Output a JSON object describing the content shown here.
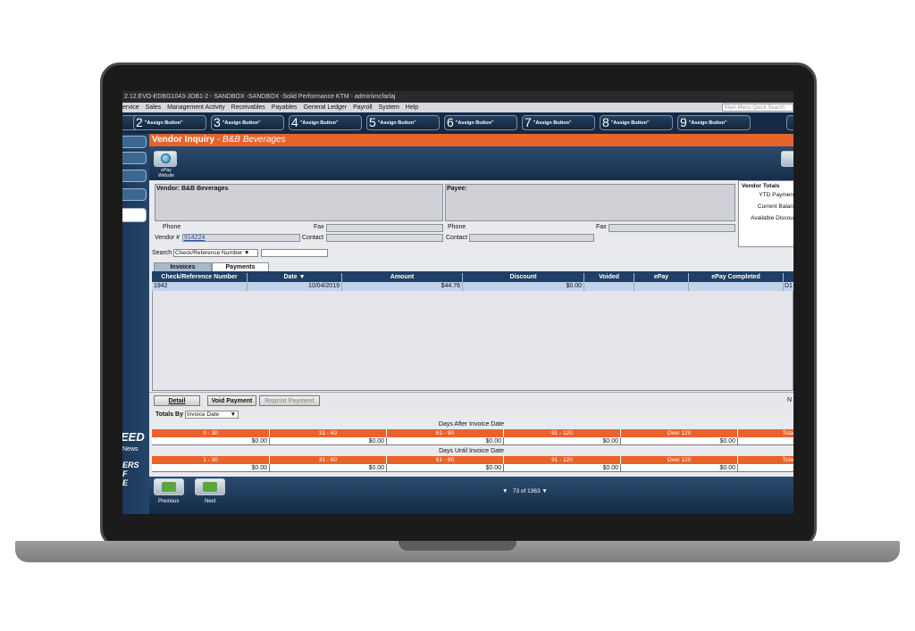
{
  "window": {
    "title": "2.12.EVO-EDBG1043-JOB1-2 - SANDBOX -SANDBOX -Solid Performance KTM - admin\\mcfarlaj"
  },
  "menu": {
    "items": [
      "ervice",
      "Sales",
      "Management Activity",
      "Receivables",
      "Payables",
      "General Ledger",
      "Payroll",
      "System",
      "Help"
    ],
    "quick_search_placeholder": "Main Menu Quick Search"
  },
  "assign_buttons": [
    {
      "num": "2",
      "label": "\"Assign Button\""
    },
    {
      "num": "3",
      "label": "\"Assign Button\""
    },
    {
      "num": "4",
      "label": "\"Assign Button\""
    },
    {
      "num": "5",
      "label": "\"Assign Button\""
    },
    {
      "num": "6",
      "label": "\"Assign Button\""
    },
    {
      "num": "7",
      "label": "\"Assign Button\""
    },
    {
      "num": "8",
      "label": "\"Assign Button\""
    },
    {
      "num": "9",
      "label": "\"Assign Button\""
    }
  ],
  "sidebar": {
    "brand_1": "EED",
    "brand_2": "News",
    "brand_3": "ERS",
    "brand_4": "F",
    "brand_5": "E"
  },
  "header": {
    "title": "Vendor Inquiry",
    "separator": " - ",
    "vendor_name": "B&B Beverages"
  },
  "toolbar": {
    "epay_label_1": "ePay",
    "epay_label_2": "Website"
  },
  "vendor": {
    "vendor_label": "Vendor: B&B Beverages",
    "payee_label": "Payee:",
    "phone_label": "Phone",
    "fax_label": "Fax",
    "vendor_num_label": "Vendor #",
    "vendor_num": "914224",
    "contact_label": "Contact"
  },
  "vendor_totals": {
    "title": "Vendor Totals",
    "ytd": "YTD Paymen",
    "current": "Current Balan",
    "available": "Available Discou"
  },
  "search": {
    "label": "Search",
    "selected": "Check/Reference Number"
  },
  "tabs": {
    "invoices": "Invoices",
    "payments": "Payments"
  },
  "grid": {
    "headers": [
      "Check/Reference Number",
      "Date ▼",
      "Amount",
      "Discount",
      "Voided",
      "ePay",
      "ePay Completed"
    ],
    "row": {
      "check": "1942",
      "date": "10/04/2019",
      "amount": "$44.76",
      "discount": "$0.00",
      "extra": "D1"
    }
  },
  "actions": {
    "detail": "Detail",
    "void": "Void Payment",
    "reprint": "Reprint Payment",
    "right_char": "N"
  },
  "totals": {
    "label": "Totals By",
    "selected": "Invoice Date",
    "after_title": "Days After Invoice Date",
    "after_buckets": [
      "0 - 30",
      "31 - 60",
      "61 - 90",
      "91 - 120",
      "Over 120",
      "Tota"
    ],
    "after_values": [
      "$0.00",
      "$0.00",
      "$0.00",
      "$0.00",
      "$0.00"
    ],
    "until_title": "Days Until Invoice Date",
    "until_buckets": [
      "1 - 30",
      "31 - 60",
      "61 - 90",
      "91 - 120",
      "Over 120",
      "Tota"
    ],
    "until_values": [
      "$0.00",
      "$0.00",
      "$0.00",
      "$0.00",
      "$0.00"
    ]
  },
  "nav": {
    "previous": "Previous",
    "next": "Next",
    "current": "73",
    "of_label": "of",
    "total": "1363"
  }
}
